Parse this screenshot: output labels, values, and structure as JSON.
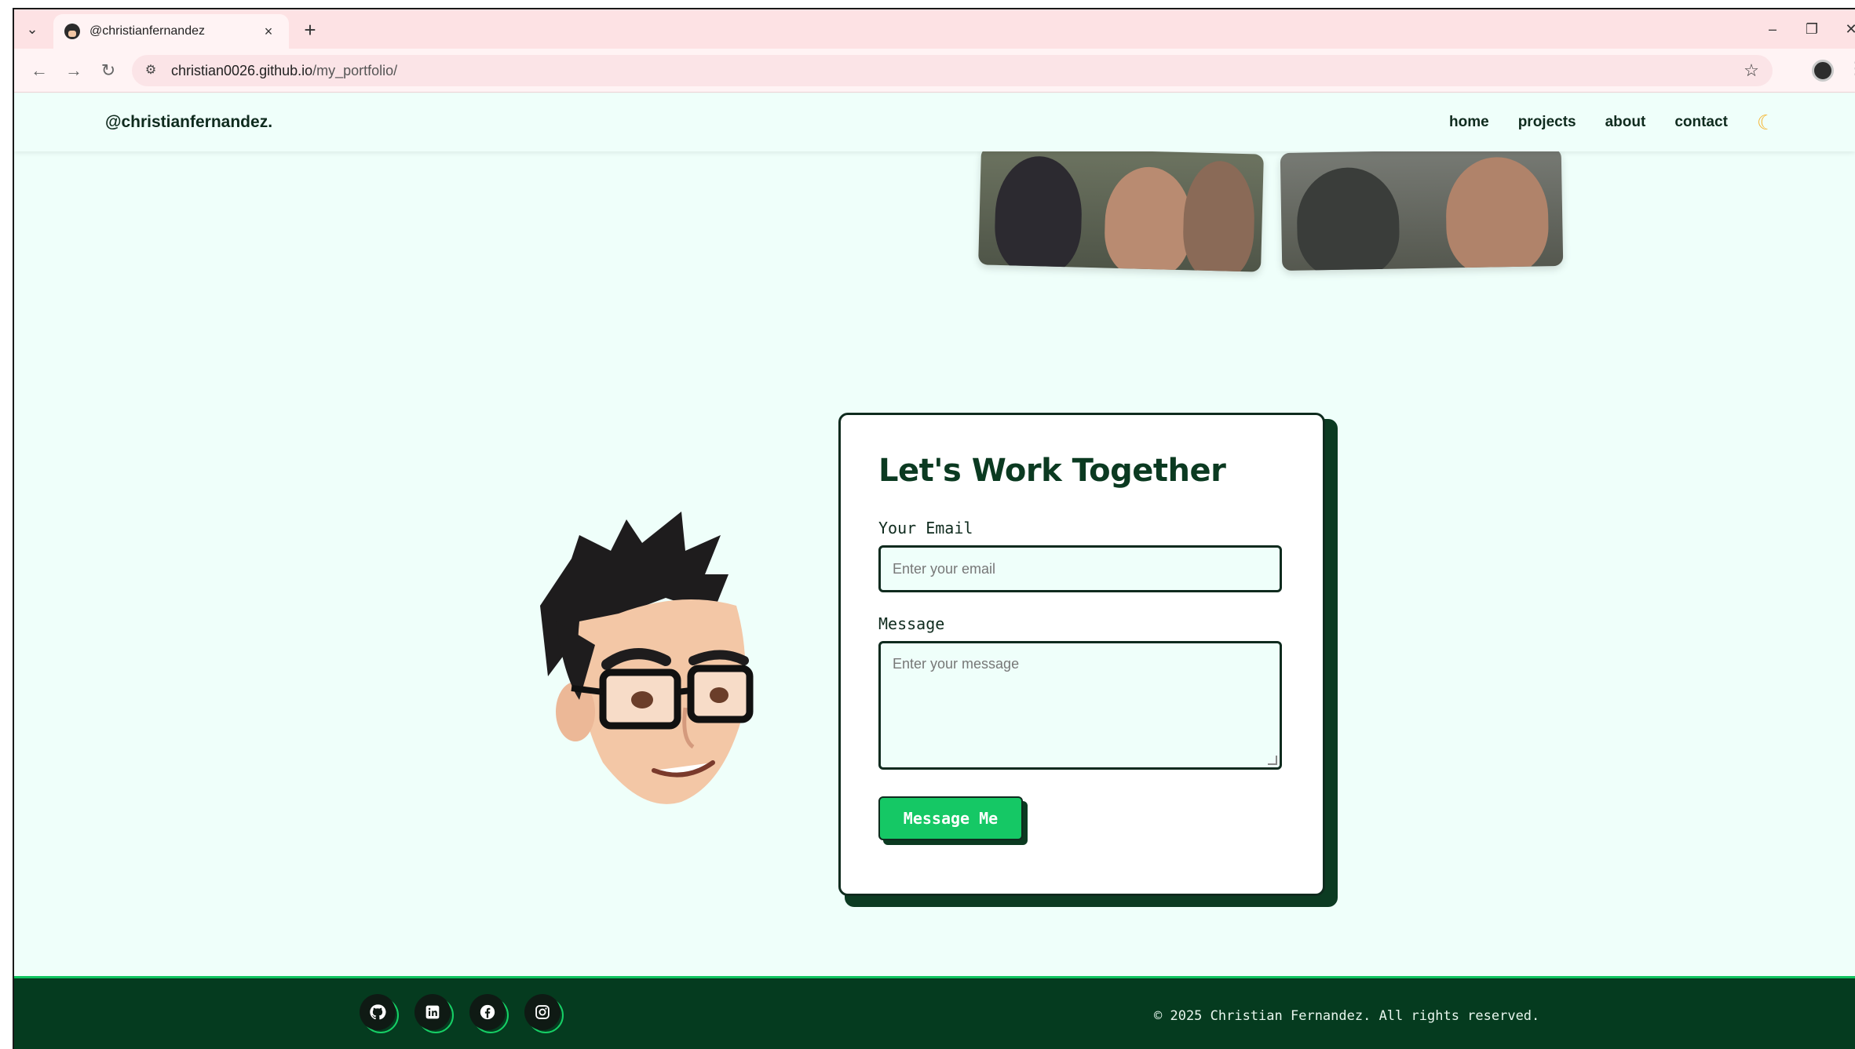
{
  "browser": {
    "tab_title": "@christianfernandez",
    "tab_close": "×",
    "new_tab": "+",
    "url_host": "christian0026.github.io",
    "url_path": "/my_portfolio/",
    "icons": {
      "tab_list": "chevron-down-icon",
      "back": "arrow-left-icon",
      "forward": "arrow-right-icon",
      "reload": "reload-icon",
      "site_info": "tune-icon",
      "bookmark": "star-icon",
      "minimize": "minimize-icon",
      "restore": "restore-icon",
      "close": "close-icon"
    }
  },
  "site": {
    "brand": "@christianfernandez.",
    "nav": [
      "home",
      "projects",
      "about",
      "contact"
    ],
    "theme_toggle_icon": "moon-icon"
  },
  "contact": {
    "heading": "Let's Work Together",
    "email_label": "Your Email",
    "email_placeholder": "Enter your email",
    "message_label": "Message",
    "message_placeholder": "Enter your message",
    "submit_label": "Message Me"
  },
  "footer": {
    "socials": [
      "github-icon",
      "linkedin-icon",
      "facebook-icon",
      "instagram-icon"
    ],
    "copyright": "© 2025 Christian Fernandez. All rights reserved."
  },
  "colors": {
    "page_bg": "#effffa",
    "accent_green": "#15c865",
    "dark_green": "#053b1f",
    "tab_strip": "#fde2e4"
  }
}
